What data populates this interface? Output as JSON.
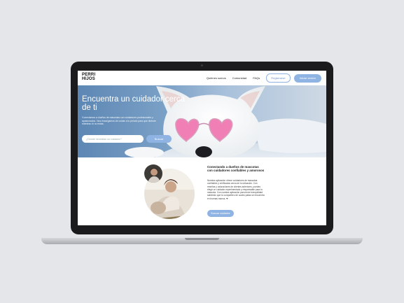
{
  "brand": {
    "line1": "PERRI",
    "line2": "HIJOS"
  },
  "nav": {
    "links": [
      "Quiénes somos",
      "Comunidad",
      "FAQs"
    ],
    "register_label": "Registrarse",
    "login_label": "Iniciar sesión"
  },
  "hero": {
    "title": "Encuentra un cuidador cerca de ti",
    "subtitle": "Conectamos a dueños de mascotas con cuidadores profesionales y apasionados. Nos encargamos de cuidar a tu peludo para que disfrute mientras tú no estás.",
    "search_placeholder": "¿Dónde necesitas un cuidador?",
    "search_button": "Buscar"
  },
  "connect": {
    "title": "Conectando a dueños de mascotas con cuidadores confiables y amorosos",
    "body": "Nuestra aplicación ofrece cuidadores de mascotas confiables y verificados cerca de tu ubicación. Con reseñas y valoraciones de clientes anteriores, puedes elegir un cuidador experimentado y responsable para tu mascota. Con nuestra aplicación para tener tranquilidad sabiendo que tu compañero de cuatro patas se encuentra en buenas manos. ❤",
    "button": "Buscar cuidador"
  },
  "colors": {
    "accent": "#8fb4e4",
    "laptop_frame": "#1b1b1d",
    "background": "#e4e6ea"
  }
}
